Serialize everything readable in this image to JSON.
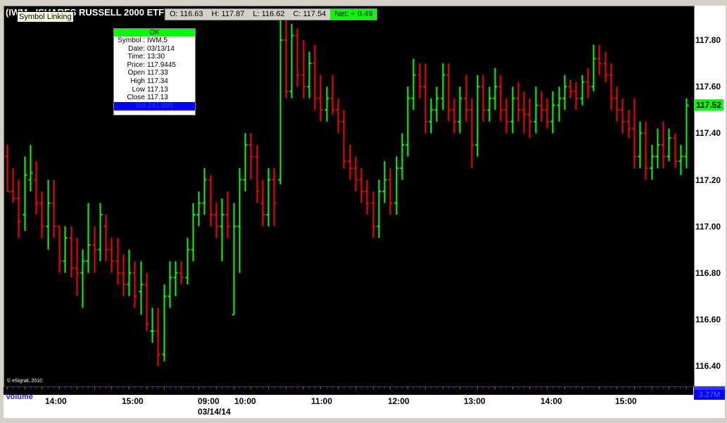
{
  "header": {
    "title": "(IWM - ISHARES RUSSELL 2000 ETF)",
    "tooltip": "Symbol Linking"
  },
  "ohlc": {
    "open": "O: 116.63",
    "high": "H: 117.87",
    "low": "L: 116.62",
    "close": "C: 117.54",
    "net": "Net: + 0.49"
  },
  "cursor": {
    "ok_label": "OK",
    "rows": [
      {
        "label": "Symbol :",
        "value": "IWM,5"
      },
      {
        "label": "Date:",
        "value": "03/13/14"
      },
      {
        "label": "Time:",
        "value": "13:30"
      },
      {
        "label": "Price:",
        "value": "117.9445"
      },
      {
        "label": "Open",
        "value": "117.33"
      },
      {
        "label": "High",
        "value": "117.34"
      },
      {
        "label": "Low",
        "value": "117.13"
      },
      {
        "label": "Close",
        "value": "117.13"
      }
    ],
    "vol_label": "Vol 241,895"
  },
  "price_axis": [
    "117.80",
    "117.60",
    "117.40",
    "117.20",
    "117.00",
    "116.80",
    "116.60",
    "116.40"
  ],
  "last_price": "117.52",
  "volume": {
    "label": "Volume",
    "readout": "3.27M"
  },
  "copyright": "© eSignal, 2010",
  "time_axis": [
    {
      "label": "14:00"
    },
    {
      "label": "15:00"
    },
    {
      "label": "09:00",
      "sub": "03/14/14"
    },
    {
      "label": "10:00"
    },
    {
      "label": "11:00"
    },
    {
      "label": "12:00"
    },
    {
      "label": "13:00"
    },
    {
      "label": "14:00"
    },
    {
      "label": "15:00"
    }
  ],
  "colors": {
    "up": "#00ff00",
    "down": "#ff0000",
    "background": "#000000"
  },
  "chart_data": {
    "type": "ohlc",
    "ylim": [
      116.3,
      117.95
    ],
    "bars": [
      [
        117.3,
        117.35,
        117.15,
        117.15
      ],
      [
        117.15,
        117.25,
        117.1,
        117.12
      ],
      [
        117.12,
        117.2,
        116.95,
        117.02
      ],
      [
        117.05,
        117.3,
        116.98,
        117.22
      ],
      [
        117.2,
        117.35,
        117.15,
        117.23
      ],
      [
        117.2,
        117.28,
        117.05,
        117.1
      ],
      [
        117.1,
        117.15,
        116.95,
        117.0
      ],
      [
        117.0,
        117.2,
        116.9,
        117.1
      ],
      [
        117.1,
        117.2,
        116.95,
        117.0
      ],
      [
        117.0,
        117.0,
        116.8,
        116.85
      ],
      [
        116.85,
        117.0,
        116.8,
        116.95
      ],
      [
        116.95,
        117.0,
        116.78,
        116.82
      ],
      [
        116.82,
        116.95,
        116.7,
        116.8
      ],
      [
        116.8,
        116.9,
        116.65,
        116.85
      ],
      [
        116.85,
        117.1,
        116.8,
        116.92
      ],
      [
        116.92,
        117.0,
        116.8,
        116.9
      ],
      [
        116.9,
        117.1,
        116.85,
        117.05
      ],
      [
        117.0,
        117.05,
        116.85,
        116.9
      ],
      [
        116.9,
        116.95,
        116.8,
        116.85
      ],
      [
        116.85,
        116.95,
        116.75,
        116.8
      ],
      [
        116.8,
        116.88,
        116.7,
        116.75
      ],
      [
        116.75,
        116.9,
        116.7,
        116.8
      ],
      [
        116.8,
        116.85,
        116.65,
        116.7
      ],
      [
        116.72,
        116.85,
        116.62,
        116.75
      ],
      [
        116.75,
        116.8,
        116.55,
        116.58
      ],
      [
        116.55,
        116.65,
        116.5,
        116.55
      ],
      [
        116.55,
        116.65,
        116.4,
        116.45
      ],
      [
        116.45,
        116.75,
        116.42,
        116.7
      ],
      [
        116.7,
        116.85,
        116.65,
        116.78
      ],
      [
        116.78,
        116.85,
        116.7,
        116.8
      ],
      [
        116.8,
        116.85,
        116.75,
        116.78
      ],
      [
        116.78,
        116.95,
        116.75,
        116.9
      ],
      [
        116.9,
        117.1,
        116.85,
        117.05
      ],
      [
        117.05,
        117.15,
        117.0,
        117.1
      ],
      [
        117.1,
        117.25,
        117.05,
        117.2
      ],
      [
        117.2,
        117.22,
        117.0,
        117.05
      ],
      [
        117.05,
        117.1,
        116.95,
        117.0
      ],
      [
        117.0,
        117.12,
        116.85,
        117.05
      ],
      [
        117.05,
        117.15,
        116.95,
        117.0
      ],
      [
        116.62,
        117.1,
        116.62,
        117.0
      ],
      [
        117.0,
        117.25,
        116.8,
        117.2
      ],
      [
        117.2,
        117.4,
        117.15,
        117.35
      ],
      [
        117.35,
        117.4,
        117.2,
        117.3
      ],
      [
        117.3,
        117.35,
        117.1,
        117.15
      ],
      [
        117.1,
        117.2,
        117.0,
        117.05
      ],
      [
        117.05,
        117.25,
        117.0,
        117.2
      ],
      [
        117.2,
        117.25,
        117.0,
        117.1
      ],
      [
        117.2,
        117.9,
        117.18,
        117.8
      ],
      [
        117.8,
        117.9,
        117.55,
        117.58
      ],
      [
        117.58,
        117.87,
        117.55,
        117.82
      ],
      [
        117.82,
        117.85,
        117.6,
        117.65
      ],
      [
        117.65,
        117.8,
        117.55,
        117.6
      ],
      [
        117.6,
        117.75,
        117.55,
        117.7
      ],
      [
        117.7,
        117.78,
        117.5,
        117.55
      ],
      [
        117.55,
        117.65,
        117.45,
        117.5
      ],
      [
        117.5,
        117.6,
        117.45,
        117.55
      ],
      [
        117.55,
        117.65,
        117.48,
        117.5
      ],
      [
        117.5,
        117.55,
        117.4,
        117.45
      ],
      [
        117.45,
        117.5,
        117.25,
        117.28
      ],
      [
        117.28,
        117.35,
        117.2,
        117.25
      ],
      [
        117.25,
        117.3,
        117.15,
        117.2
      ],
      [
        117.2,
        117.25,
        117.1,
        117.15
      ],
      [
        117.15,
        117.2,
        117.05,
        117.1
      ],
      [
        117.1,
        117.15,
        116.95,
        117.0
      ],
      [
        117.0,
        117.2,
        116.95,
        117.15
      ],
      [
        117.15,
        117.28,
        117.1,
        117.2
      ],
      [
        117.2,
        117.25,
        117.05,
        117.1
      ],
      [
        117.1,
        117.3,
        117.05,
        117.25
      ],
      [
        117.25,
        117.4,
        117.2,
        117.35
      ],
      [
        117.35,
        117.6,
        117.3,
        117.55
      ],
      [
        117.55,
        117.72,
        117.5,
        117.65
      ],
      [
        117.65,
        117.7,
        117.55,
        117.6
      ],
      [
        117.6,
        117.7,
        117.4,
        117.45
      ],
      [
        117.45,
        117.55,
        117.4,
        117.5
      ],
      [
        117.5,
        117.6,
        117.45,
        117.55
      ],
      [
        117.55,
        117.7,
        117.5,
        117.65
      ],
      [
        117.65,
        117.7,
        117.45,
        117.5
      ],
      [
        117.5,
        117.55,
        117.4,
        117.45
      ],
      [
        117.45,
        117.6,
        117.4,
        117.55
      ],
      [
        117.55,
        117.65,
        117.45,
        117.5
      ],
      [
        117.5,
        117.55,
        117.25,
        117.35
      ],
      [
        117.35,
        117.65,
        117.3,
        117.6
      ],
      [
        117.6,
        117.65,
        117.45,
        117.5
      ],
      [
        117.5,
        117.6,
        117.45,
        117.55
      ],
      [
        117.55,
        117.68,
        117.5,
        117.6
      ],
      [
        117.6,
        117.65,
        117.45,
        117.5
      ],
      [
        117.5,
        117.55,
        117.4,
        117.45
      ],
      [
        117.45,
        117.6,
        117.4,
        117.55
      ],
      [
        117.55,
        117.62,
        117.45,
        117.5
      ],
      [
        117.5,
        117.58,
        117.4,
        117.48
      ],
      [
        117.48,
        117.55,
        117.38,
        117.45
      ],
      [
        117.45,
        117.6,
        117.4,
        117.52
      ],
      [
        117.52,
        117.58,
        117.45,
        117.5
      ],
      [
        117.5,
        117.55,
        117.42,
        117.45
      ],
      [
        117.45,
        117.58,
        117.4,
        117.52
      ],
      [
        117.52,
        117.6,
        117.45,
        117.55
      ],
      [
        117.55,
        117.65,
        117.5,
        117.6
      ],
      [
        117.6,
        117.63,
        117.55,
        117.58
      ],
      [
        117.58,
        117.62,
        117.5,
        117.55
      ],
      [
        117.55,
        117.65,
        117.52,
        117.62
      ],
      [
        117.62,
        117.68,
        117.55,
        117.6
      ],
      [
        117.6,
        117.78,
        117.58,
        117.72
      ],
      [
        117.72,
        117.78,
        117.65,
        117.7
      ],
      [
        117.7,
        117.75,
        117.62,
        117.65
      ],
      [
        117.65,
        117.7,
        117.5,
        117.55
      ],
      [
        117.55,
        117.6,
        117.45,
        117.5
      ],
      [
        117.5,
        117.55,
        117.4,
        117.45
      ],
      [
        117.45,
        117.5,
        117.38,
        117.42
      ],
      [
        117.42,
        117.55,
        117.25,
        117.3
      ],
      [
        117.3,
        117.45,
        117.25,
        117.4
      ],
      [
        117.4,
        117.45,
        117.2,
        117.25
      ],
      [
        117.25,
        117.35,
        117.2,
        117.3
      ],
      [
        117.3,
        117.42,
        117.25,
        117.35
      ],
      [
        117.35,
        117.45,
        117.25,
        117.3
      ],
      [
        117.3,
        117.42,
        117.28,
        117.38
      ],
      [
        117.38,
        117.4,
        117.25,
        117.28
      ],
      [
        117.28,
        117.35,
        117.22,
        117.3
      ],
      [
        117.3,
        117.55,
        117.25,
        117.52
      ]
    ]
  }
}
